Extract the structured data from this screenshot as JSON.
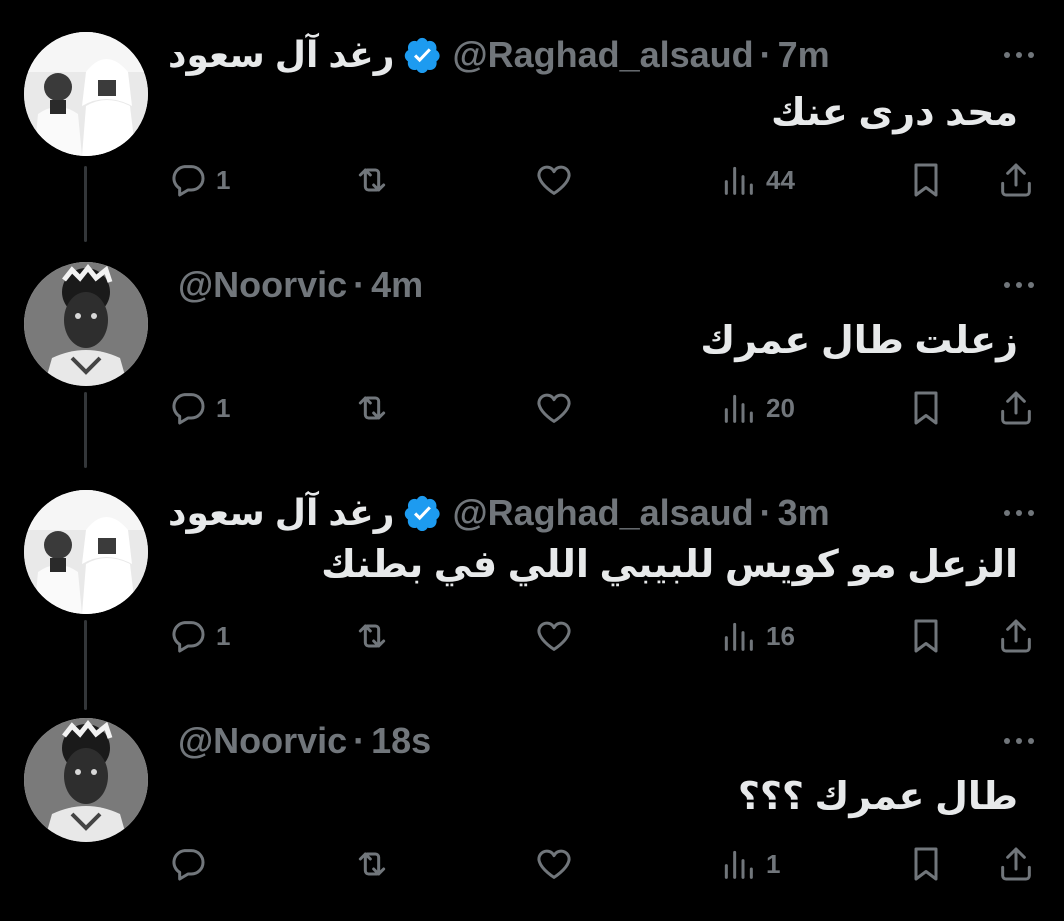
{
  "colors": {
    "background": "#000000",
    "text": "#e7e9ea",
    "muted": "#71767b",
    "verified": "#1d9bf0",
    "thread_line": "#333639"
  },
  "tweets": [
    {
      "display_name": "رغد آل سعود",
      "verified": true,
      "handle": "@Raghad_alsaud",
      "separator": "·",
      "time": "7m",
      "text": "محد درى عنك",
      "avatar": "two-men-photo-avatar",
      "replies": "1",
      "retweets": "",
      "likes": "",
      "views": "44"
    },
    {
      "display_name": "",
      "verified": false,
      "handle": "@Noorvic",
      "separator": "·",
      "time": "4m",
      "text": "زعلت طال عمرك",
      "avatar": "footballer-photo-avatar",
      "replies": "1",
      "retweets": "",
      "likes": "",
      "views": "20"
    },
    {
      "display_name": "رغد آل سعود",
      "verified": true,
      "handle": "@Raghad_alsaud",
      "separator": "·",
      "time": "3m",
      "text": "الزعل مو كويس للبيبي اللي في بطنك",
      "avatar": "two-men-photo-avatar",
      "replies": "1",
      "retweets": "",
      "likes": "",
      "views": "16"
    },
    {
      "display_name": "",
      "verified": false,
      "handle": "@Noorvic",
      "separator": "·",
      "time": "18s",
      "text": "طال عمرك ؟؟؟",
      "avatar": "footballer-photo-avatar",
      "replies": "",
      "retweets": "",
      "likes": "",
      "views": "1"
    }
  ]
}
